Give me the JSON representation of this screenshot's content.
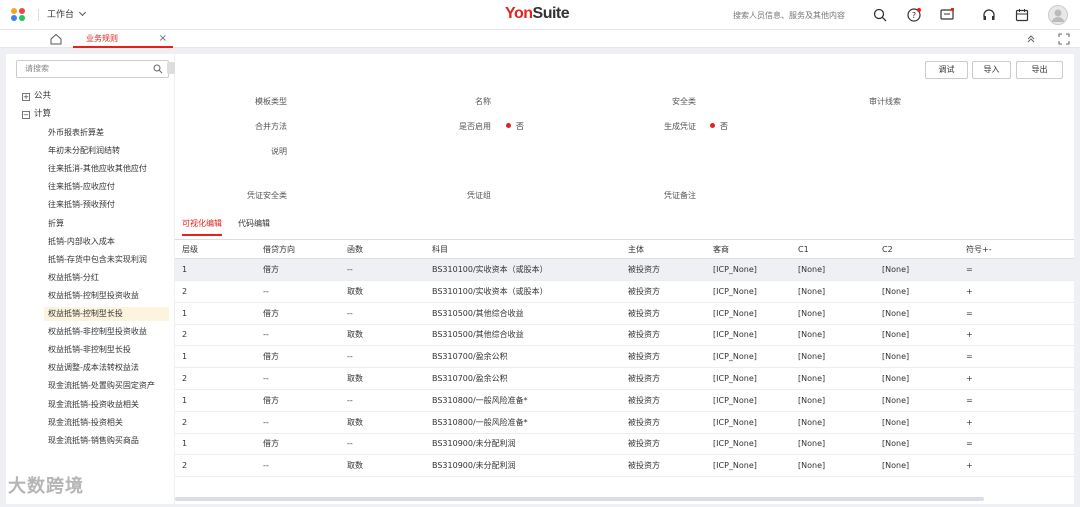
{
  "topbar": {
    "workbench_label": "工作台",
    "brand_you": "Yon",
    "brand_suite": "Suite",
    "search_placeholder": "搜索人员信息、服务及其他内容",
    "colors": {
      "brand_red": "#e2231a",
      "logo_orange": "#f5a623",
      "logo_blue": "#3b82f6",
      "logo_green": "#22c55e",
      "logo_red": "#ef4444"
    },
    "icons": [
      "search-icon",
      "help-icon",
      "message-icon",
      "headset-icon",
      "calendar-icon",
      "avatar"
    ]
  },
  "tabs": {
    "home_icon": "home-icon",
    "active_tab": "业务规则",
    "close": "×"
  },
  "sidebar": {
    "search_placeholder": "请搜索",
    "nodes": [
      {
        "label": "公共",
        "expand": "+"
      },
      {
        "label": "计算",
        "expand": "−"
      }
    ],
    "items": [
      "外币报表折算差",
      "年初未分配利润结转",
      "往来抵消-其他应收其他应付",
      "往来抵销-应收应付",
      "往来抵销-预收预付",
      "折算",
      "抵销-内部收入成本",
      "抵销-存货中包含未实现利润",
      "权益抵销-分红",
      "权益抵销-控制型投资收益",
      "权益抵销-控制型长投",
      "权益抵销-非控制型投资收益",
      "权益抵销-非控制型长投",
      "权益调整-成本法转权益法",
      "现金流抵销-处置购买固定资产",
      "现金流抵销-投资收益相关",
      "现金流抵销-投资相关",
      "现金流抵销-销售购买商品"
    ],
    "active_index": 10
  },
  "toolbar": {
    "debug": "调试",
    "import": "导入",
    "export": "导出"
  },
  "form": {
    "template_type_label": "模板类型",
    "name_label": "名称",
    "security_label": "安全类",
    "audit_label": "审计线索",
    "merge_method_label": "合并方法",
    "enabled_label": "是否启用",
    "enabled_value": "否",
    "gen_voucher_label": "生成凭证",
    "gen_voucher_value": "否",
    "desc_label": "说明",
    "voucher_security_label": "凭证安全类",
    "voucher_group_label": "凭证组",
    "voucher_remark_label": "凭证备注"
  },
  "subtabs": {
    "visual": "可视化编辑",
    "code": "代码编辑"
  },
  "grid": {
    "columns": [
      "层级",
      "借贷方向",
      "函数",
      "科目",
      "主体",
      "客商",
      "C1",
      "C2",
      "符号+-"
    ],
    "rows": [
      [
        "1",
        "借方",
        "--",
        "BS310100/实收资本（或股本）",
        "被投资方",
        "[ICP_None]",
        "[None]",
        "[None]",
        "="
      ],
      [
        "2",
        "--",
        "取数",
        "BS310100/实收资本（或股本）",
        "被投资方",
        "[ICP_None]",
        "[None]",
        "[None]",
        "+"
      ],
      [
        "1",
        "借方",
        "--",
        "BS310500/其他综合收益",
        "被投资方",
        "[ICP_None]",
        "[None]",
        "[None]",
        "="
      ],
      [
        "2",
        "--",
        "取数",
        "BS310500/其他综合收益",
        "被投资方",
        "[ICP_None]",
        "[None]",
        "[None]",
        "+"
      ],
      [
        "1",
        "借方",
        "--",
        "BS310700/盈余公积",
        "被投资方",
        "[ICP_None]",
        "[None]",
        "[None]",
        "="
      ],
      [
        "2",
        "--",
        "取数",
        "BS310700/盈余公积",
        "被投资方",
        "[ICP_None]",
        "[None]",
        "[None]",
        "+"
      ],
      [
        "1",
        "借方",
        "--",
        "BS310800/一般风险准备*",
        "被投资方",
        "[ICP_None]",
        "[None]",
        "[None]",
        "="
      ],
      [
        "2",
        "--",
        "取数",
        "BS310800/一般风险准备*",
        "被投资方",
        "[ICP_None]",
        "[None]",
        "[None]",
        "+"
      ],
      [
        "1",
        "借方",
        "--",
        "BS310900/未分配利润",
        "被投资方",
        "[ICP_None]",
        "[None]",
        "[None]",
        "="
      ],
      [
        "2",
        "--",
        "取数",
        "BS310900/未分配利润",
        "被投资方",
        "[ICP_None]",
        "[None]",
        "[None]",
        "+"
      ]
    ],
    "selected_row": 0
  },
  "watermark": "大数跨境"
}
